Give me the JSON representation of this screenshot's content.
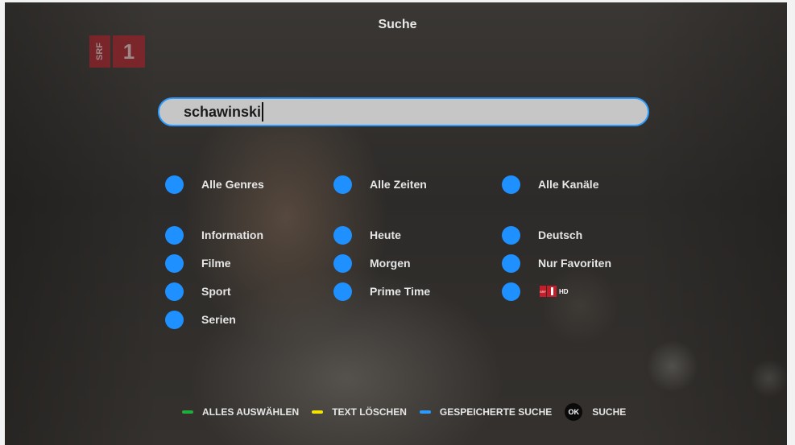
{
  "header": {
    "title": "Suche"
  },
  "channel_logo": {
    "srf": "SRF",
    "one": "1"
  },
  "search": {
    "value": "schawinski"
  },
  "options": {
    "col1": [
      "Alle Genres",
      "Information",
      "Filme",
      "Sport",
      "Serien"
    ],
    "col2": [
      "Alle Zeiten",
      "Heute",
      "Morgen",
      "Prime Time"
    ],
    "col3": [
      "Alle Kanäle",
      "Deutsch",
      "Nur Favoriten"
    ],
    "col3_logo": {
      "srf": "SRF",
      "hd": "HD"
    }
  },
  "footer": {
    "hints": [
      {
        "color": "#1fae3a",
        "label": "ALLES AUSWÄHLEN"
      },
      {
        "color": "#f3e400",
        "label": "TEXT LÖSCHEN"
      },
      {
        "color": "#2b9bff",
        "label": "GESPEICHERTE SUCHE"
      }
    ],
    "ok_key": "OK",
    "ok_label": "SUCHE"
  },
  "colors": {
    "accent": "#1e90ff",
    "search_border": "#2b9bff",
    "logo_red": "#b31d28"
  }
}
